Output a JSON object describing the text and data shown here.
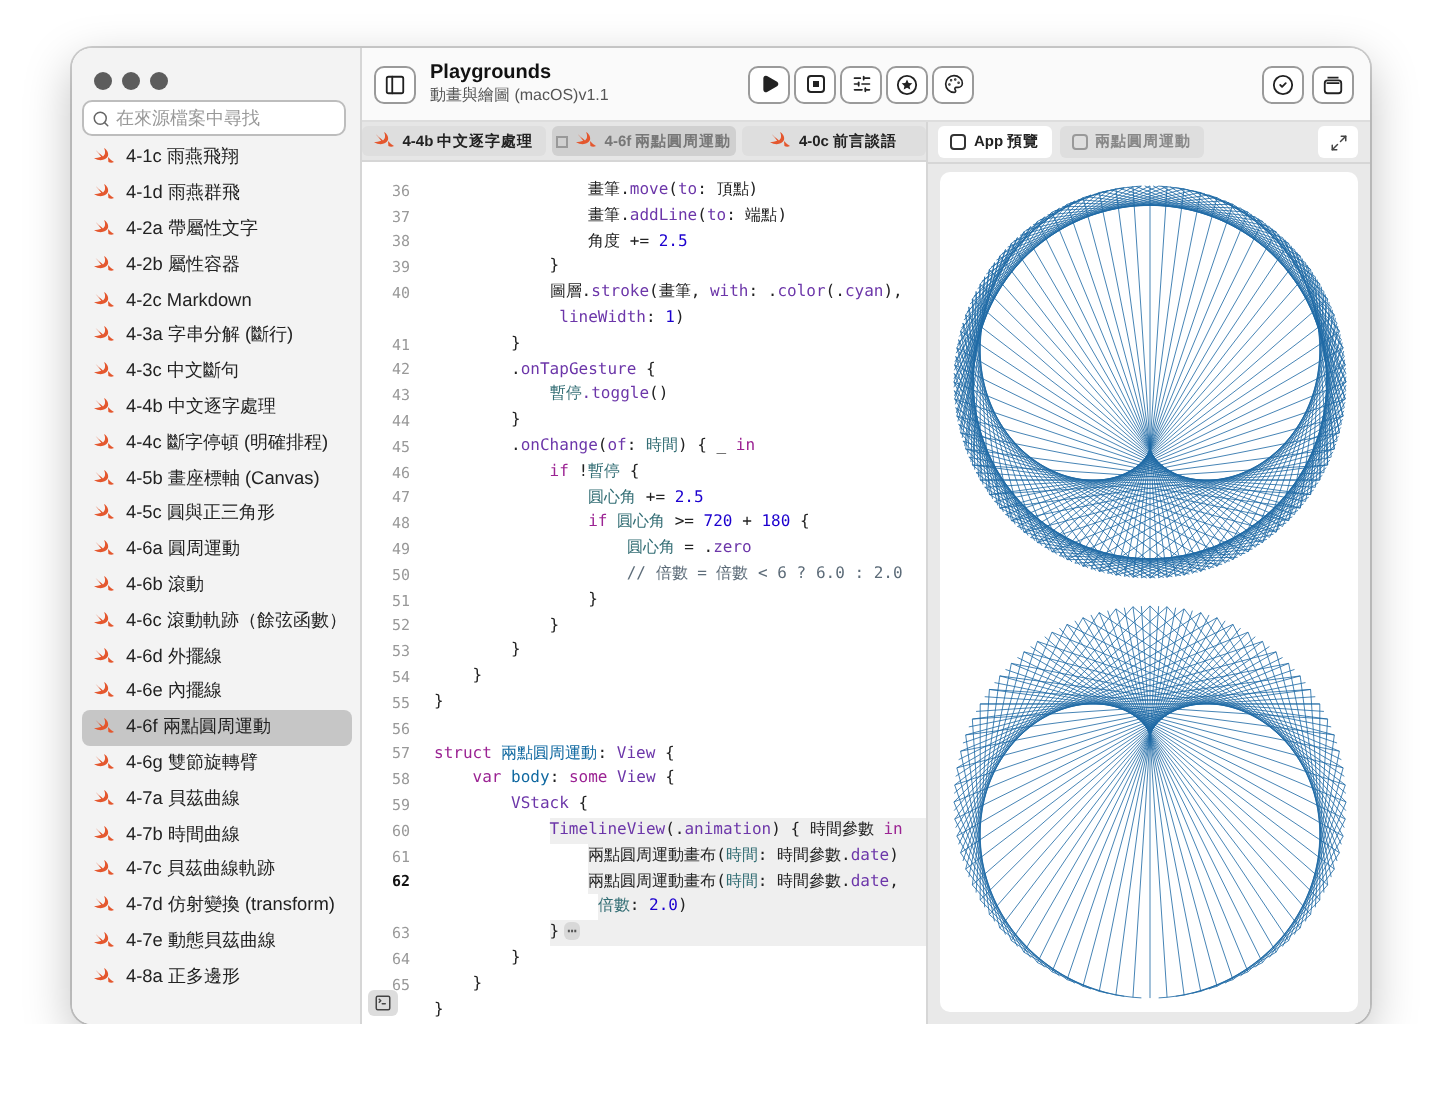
{
  "window": {
    "title": "Playgrounds",
    "subtitle": "動畫與繪圖 (macOS)v1.1"
  },
  "search": {
    "placeholder": "在來源檔案中尋找"
  },
  "sidebar": {
    "items": [
      {
        "label": "4-1c 雨燕飛翔",
        "selected": false
      },
      {
        "label": "4-1d 雨燕群飛",
        "selected": false
      },
      {
        "label": "4-2a 帶屬性文字",
        "selected": false
      },
      {
        "label": "4-2b 屬性容器",
        "selected": false
      },
      {
        "label": "4-2c Markdown",
        "selected": false
      },
      {
        "label": "4-3a 字串分解 (斷行)",
        "selected": false
      },
      {
        "label": "4-3c 中文斷句",
        "selected": false
      },
      {
        "label": "4-4b 中文逐字處理",
        "selected": false
      },
      {
        "label": "4-4c 斷字停頓 (明確排程)",
        "selected": false
      },
      {
        "label": "4-5b 畫座標軸 (Canvas)",
        "selected": false
      },
      {
        "label": "4-5c 圓與正三角形",
        "selected": false
      },
      {
        "label": "4-6a 圓周運動",
        "selected": false
      },
      {
        "label": "4-6b 滾動",
        "selected": false
      },
      {
        "label": "4-6c 滾動軌跡（餘弦函數）",
        "selected": false
      },
      {
        "label": "4-6d 外擺線",
        "selected": false
      },
      {
        "label": "4-6e 內擺線",
        "selected": false
      },
      {
        "label": "4-6f 兩點圓周運動",
        "selected": true
      },
      {
        "label": "4-6g 雙節旋轉臂",
        "selected": false
      },
      {
        "label": "4-7a 貝茲曲線",
        "selected": false
      },
      {
        "label": "4-7b 時間曲線",
        "selected": false
      },
      {
        "label": "4-7c 貝茲曲線軌跡",
        "selected": false
      },
      {
        "label": "4-7d 仿射變換 (transform)",
        "selected": false
      },
      {
        "label": "4-7e 動態貝茲曲線",
        "selected": false
      },
      {
        "label": "4-8a 正多邊形",
        "selected": false
      }
    ]
  },
  "editor_tabs": [
    {
      "label": "4-4b 中文逐字處理",
      "selected": false
    },
    {
      "label": "4-6f 兩點圓周運動",
      "selected": true
    },
    {
      "label": "4-0c 前言談語",
      "selected": false
    }
  ],
  "preview_tabs": [
    {
      "label": "App 預覽",
      "selected": true
    },
    {
      "label": "兩點圓周運動",
      "selected": false
    }
  ],
  "code_lines": [
    {
      "number": "36",
      "tokens": [
        {
          "kind": "plain",
          "text": "                畫筆."
        },
        {
          "kind": "member",
          "text": "move"
        },
        {
          "kind": "plain",
          "text": "("
        },
        {
          "kind": "member",
          "text": "to"
        },
        {
          "kind": "plain",
          "text": ": 頂點)"
        }
      ]
    },
    {
      "number": "37",
      "tokens": [
        {
          "kind": "plain",
          "text": "                畫筆."
        },
        {
          "kind": "member",
          "text": "addLine"
        },
        {
          "kind": "plain",
          "text": "("
        },
        {
          "kind": "member",
          "text": "to"
        },
        {
          "kind": "plain",
          "text": ": 端點)"
        }
      ]
    },
    {
      "number": "38",
      "tokens": [
        {
          "kind": "plain",
          "text": "                角度 += "
        },
        {
          "kind": "number",
          "text": "2.5"
        }
      ]
    },
    {
      "number": "39",
      "tokens": [
        {
          "kind": "plain",
          "text": "            }"
        }
      ]
    },
    {
      "number": "40",
      "tokens": [
        {
          "kind": "plain",
          "text": "            圖層."
        },
        {
          "kind": "member",
          "text": "stroke"
        },
        {
          "kind": "plain",
          "text": "(畫筆, "
        },
        {
          "kind": "member",
          "text": "with"
        },
        {
          "kind": "plain",
          "text": ": ."
        },
        {
          "kind": "member",
          "text": "color"
        },
        {
          "kind": "plain",
          "text": "(."
        },
        {
          "kind": "member",
          "text": "cyan"
        },
        {
          "kind": "plain",
          "text": "),"
        }
      ]
    },
    {
      "tokens": [
        {
          "kind": "member",
          "text": "             lineWidth"
        },
        {
          "kind": "plain",
          "text": ": "
        },
        {
          "kind": "number",
          "text": "1"
        },
        {
          "kind": "plain",
          "text": ")"
        }
      ]
    },
    {
      "number": "41",
      "tokens": [
        {
          "kind": "plain",
          "text": "        }"
        }
      ]
    },
    {
      "number": "42",
      "tokens": [
        {
          "kind": "plain",
          "text": "        ."
        },
        {
          "kind": "member",
          "text": "onTapGesture"
        },
        {
          "kind": "plain",
          "text": " {"
        }
      ]
    },
    {
      "number": "43",
      "tokens": [
        {
          "kind": "ident",
          "text": "            暫停"
        },
        {
          "kind": "member",
          "text": ".toggle"
        },
        {
          "kind": "plain",
          "text": "()"
        }
      ]
    },
    {
      "number": "44",
      "tokens": [
        {
          "kind": "plain",
          "text": "        }"
        }
      ]
    },
    {
      "number": "45",
      "tokens": [
        {
          "kind": "plain",
          "text": "        ."
        },
        {
          "kind": "member",
          "text": "onChange"
        },
        {
          "kind": "plain",
          "text": "("
        },
        {
          "kind": "member",
          "text": "of"
        },
        {
          "kind": "plain",
          "text": ": "
        },
        {
          "kind": "ident",
          "text": "時間"
        },
        {
          "kind": "plain",
          "text": ") { _ "
        },
        {
          "kind": "keyword",
          "text": "in"
        }
      ]
    },
    {
      "number": "46",
      "tokens": [
        {
          "kind": "keyword",
          "text": "            if"
        },
        {
          "kind": "plain",
          "text": " !"
        },
        {
          "kind": "ident",
          "text": "暫停"
        },
        {
          "kind": "plain",
          "text": " {"
        }
      ]
    },
    {
      "number": "47",
      "tokens": [
        {
          "kind": "ident",
          "text": "                圓心角"
        },
        {
          "kind": "plain",
          "text": " += "
        },
        {
          "kind": "number",
          "text": "2.5"
        }
      ]
    },
    {
      "number": "48",
      "tokens": [
        {
          "kind": "keyword",
          "text": "                if"
        },
        {
          "kind": "ident",
          "text": " 圓心角"
        },
        {
          "kind": "plain",
          "text": " >= "
        },
        {
          "kind": "number",
          "text": "720"
        },
        {
          "kind": "plain",
          "text": " + "
        },
        {
          "kind": "number",
          "text": "180"
        },
        {
          "kind": "plain",
          "text": " {"
        }
      ]
    },
    {
      "number": "49",
      "tokens": [
        {
          "kind": "ident",
          "text": "                    圓心角"
        },
        {
          "kind": "plain",
          "text": " = ."
        },
        {
          "kind": "member",
          "text": "zero"
        }
      ]
    },
    {
      "number": "50",
      "tokens": [
        {
          "kind": "comment",
          "text": "                    // 倍數 = 倍數 < 6 ? 6.0 : 2.0"
        }
      ]
    },
    {
      "number": "51",
      "tokens": [
        {
          "kind": "plain",
          "text": "                }"
        }
      ]
    },
    {
      "number": "52",
      "tokens": [
        {
          "kind": "plain",
          "text": "            }"
        }
      ]
    },
    {
      "number": "53",
      "tokens": [
        {
          "kind": "plain",
          "text": "        }"
        }
      ]
    },
    {
      "number": "54",
      "tokens": [
        {
          "kind": "plain",
          "text": "    }"
        }
      ]
    },
    {
      "number": "55",
      "tokens": [
        {
          "kind": "plain",
          "text": "}"
        }
      ]
    },
    {
      "number": "56"
    },
    {
      "number": "57",
      "tokens": [
        {
          "kind": "keyword",
          "text": "struct"
        },
        {
          "kind": "decl",
          "text": " 兩點圓周運動"
        },
        {
          "kind": "plain",
          "text": ": "
        },
        {
          "kind": "type",
          "text": "View"
        },
        {
          "kind": "plain",
          "text": " {"
        }
      ]
    },
    {
      "number": "58",
      "tokens": [
        {
          "kind": "keyword",
          "text": "    var"
        },
        {
          "kind": "decl",
          "text": " body"
        },
        {
          "kind": "plain",
          "text": ": "
        },
        {
          "kind": "keyword",
          "text": "some"
        },
        {
          "kind": "type",
          "text": " View"
        },
        {
          "kind": "plain",
          "text": " {"
        }
      ]
    },
    {
      "number": "59",
      "tokens": [
        {
          "kind": "type",
          "text": "        VStack"
        },
        {
          "kind": "plain",
          "text": " {"
        }
      ]
    },
    {
      "number": "60",
      "scope": true,
      "tokens": [
        {
          "kind": "type",
          "text": "            TimelineView"
        },
        {
          "kind": "plain",
          "text": "(."
        },
        {
          "kind": "member",
          "text": "animation"
        },
        {
          "kind": "plain",
          "text": ") { 時間參數 "
        },
        {
          "kind": "keyword",
          "text": "in"
        }
      ]
    },
    {
      "number": "61",
      "scope": true,
      "tokens": [
        {
          "kind": "plain",
          "text": "                兩點圓周運動畫布("
        },
        {
          "kind": "ident",
          "text": "時間"
        },
        {
          "kind": "plain",
          "text": ": 時間參數."
        },
        {
          "kind": "member",
          "text": "date"
        },
        {
          "kind": "plain",
          "text": ")"
        }
      ]
    },
    {
      "number": "62",
      "scope": true,
      "current": true,
      "tokens": [
        {
          "kind": "plain",
          "text": "                兩點圓周運動畫布("
        },
        {
          "kind": "ident",
          "text": "時間"
        },
        {
          "kind": "plain",
          "text": ": 時間參數."
        },
        {
          "kind": "member",
          "text": "date"
        },
        {
          "kind": "plain",
          "text": ","
        }
      ]
    },
    {
      "scope": true,
      "tokens": [
        {
          "kind": "ident",
          "text": "                 倍數"
        },
        {
          "kind": "plain",
          "text": ": "
        },
        {
          "kind": "number",
          "text": "2.0"
        },
        {
          "kind": "plain",
          "text": ")"
        }
      ]
    },
    {
      "number": "63",
      "scope": true,
      "tokens": [
        {
          "kind": "plain",
          "text": "            }"
        },
        {
          "kind": "fold",
          "text": "⋯"
        }
      ]
    },
    {
      "number": "64",
      "tokens": [
        {
          "kind": "plain",
          "text": "        }"
        }
      ]
    },
    {
      "number": "65",
      "tokens": [
        {
          "kind": "plain",
          "text": "    }"
        }
      ]
    },
    {
      "tokens": [
        {
          "kind": "plain",
          "text": "}"
        }
      ]
    }
  ]
}
